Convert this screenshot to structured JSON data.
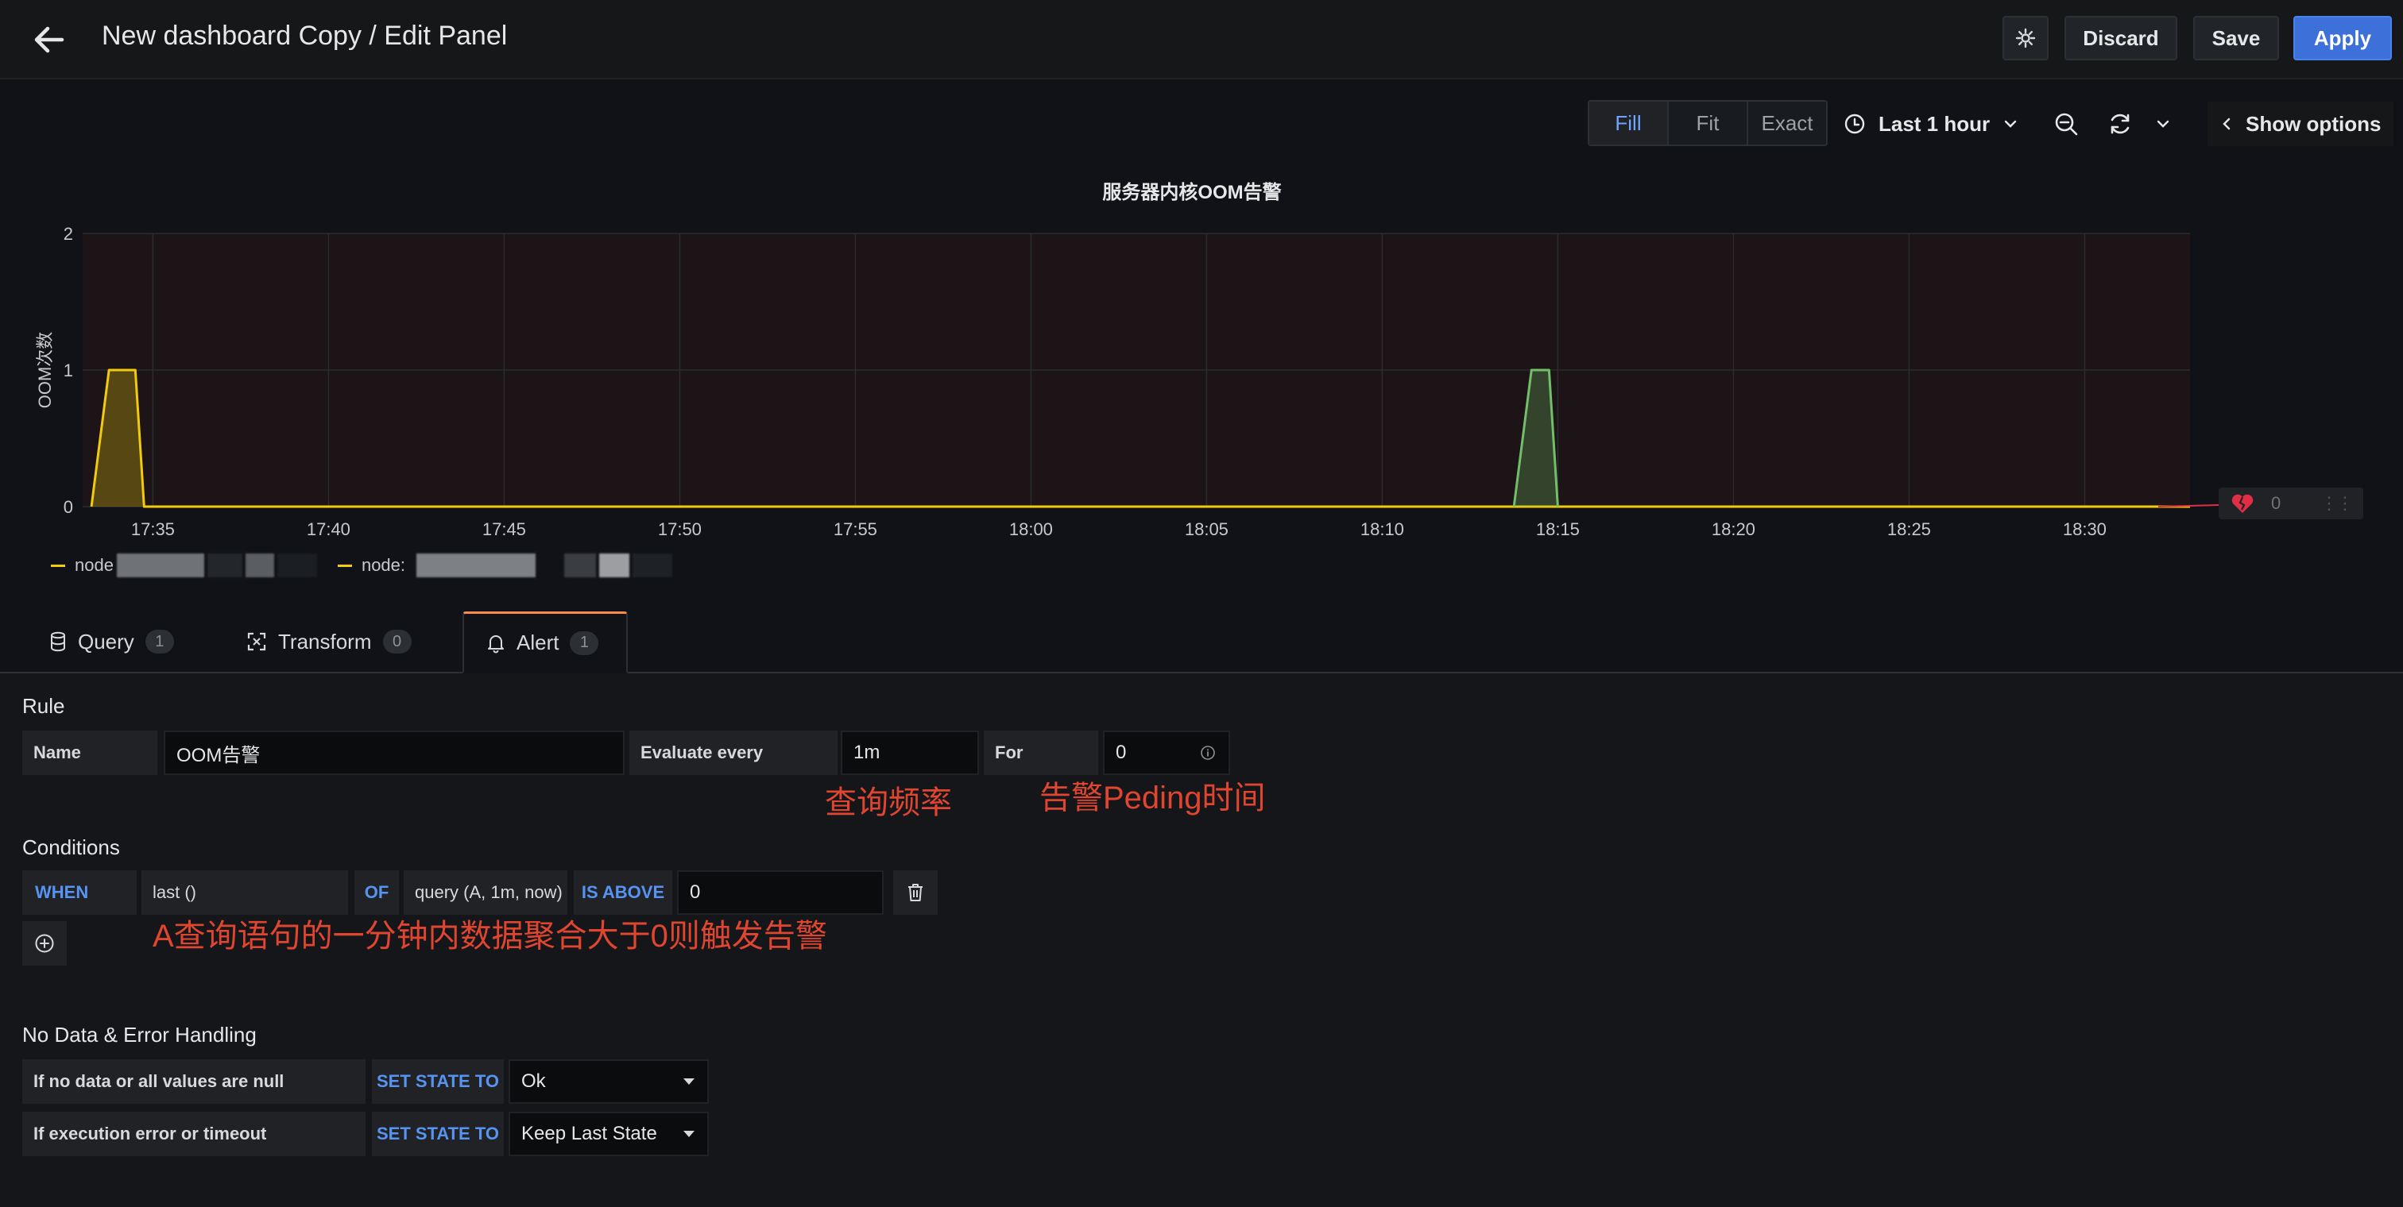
{
  "header": {
    "title": "New dashboard Copy / Edit Panel",
    "discard_label": "Discard",
    "save_label": "Save",
    "apply_label": "Apply"
  },
  "viz_controls": {
    "modes": [
      "Fill",
      "Fit",
      "Exact"
    ],
    "active_mode": "Fill",
    "time_range": "Last 1 hour",
    "show_options_label": "Show options"
  },
  "chart_data": {
    "type": "line",
    "title": "服务器内核OOM告警",
    "ylabel": "OOM次数",
    "xlabel": "",
    "ylim": [
      0,
      2
    ],
    "y_ticks": [
      "0",
      "1",
      "2"
    ],
    "x_ticks": [
      "17:35",
      "17:40",
      "17:45",
      "17:50",
      "17:55",
      "18:00",
      "18:05",
      "18:10",
      "18:15",
      "18:20",
      "18:25",
      "18:30"
    ],
    "x_range": [
      "17:33",
      "18:33"
    ],
    "grid": true,
    "legend_position": "bottom",
    "series": [
      {
        "color": "#f2cc0c",
        "points": [
          [
            "17:33:15",
            0
          ],
          [
            "17:33:45",
            1
          ],
          [
            "17:34:30",
            1
          ],
          [
            "17:34:45",
            0
          ],
          [
            "18:33",
            0
          ]
        ]
      },
      {
        "color": "#73bf69",
        "points": [
          [
            "18:13:45",
            0
          ],
          [
            "18:14:15",
            1
          ],
          [
            "18:14:45",
            1
          ],
          [
            "18:15:00",
            0
          ]
        ]
      }
    ]
  },
  "legend": {
    "items": [
      {
        "label": "node",
        "color": "#f2cc0c"
      },
      {
        "label": "node:",
        "color": "#f2cc0c"
      }
    ]
  },
  "alert_badge": {
    "value": "0"
  },
  "tabs": [
    {
      "label": "Query",
      "count": "1",
      "icon": "database-icon"
    },
    {
      "label": "Transform",
      "count": "0",
      "icon": "transform-icon"
    },
    {
      "label": "Alert",
      "count": "1",
      "icon": "bell-icon"
    }
  ],
  "rule": {
    "section_title": "Rule",
    "name_label": "Name",
    "name_value": "OOM告警",
    "evaluate_label": "Evaluate every",
    "evaluate_value": "1m",
    "for_label": "For",
    "for_value": "0"
  },
  "conditions": {
    "section_title": "Conditions",
    "when": "WHEN",
    "reducer": "last ()",
    "of": "OF",
    "query": "query (A, 1m, now)",
    "evaluator": "IS ABOVE",
    "threshold": "0"
  },
  "annotations": {
    "eval_note": "查询频率",
    "for_note": "告警Peding时间",
    "condition_note": "A查询语句的一分钟内数据聚合大于0则触发告警"
  },
  "no_data": {
    "section_title": "No Data & Error Handling",
    "no_data_label": "If no data or all values are null",
    "exec_error_label": "If execution error or timeout",
    "set_state_label": "SET STATE TO",
    "no_data_state": "Ok",
    "exec_error_state": "Keep Last State"
  },
  "colors": {
    "accent": "#3d71d9",
    "keyword": "#5794f2",
    "annotation": "#e0452f",
    "active_tab": "#f88a4d"
  }
}
